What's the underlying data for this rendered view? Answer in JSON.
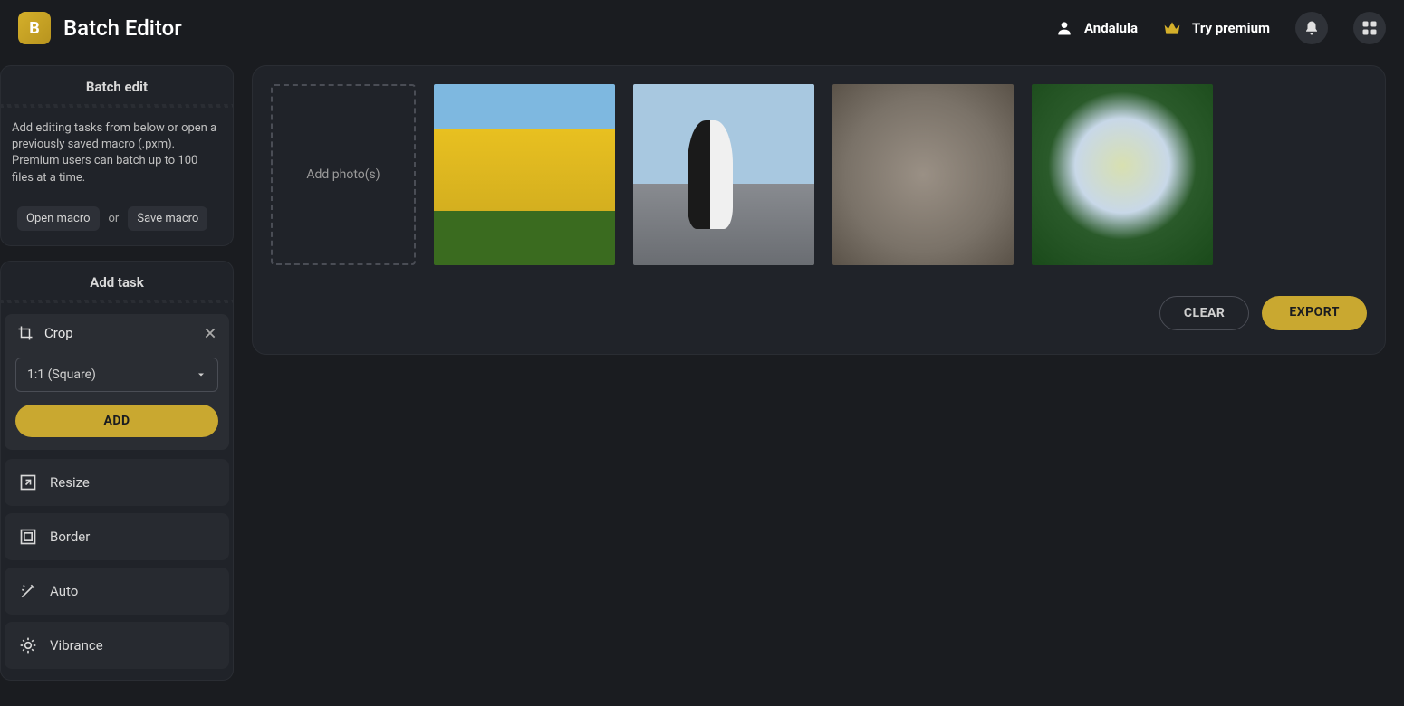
{
  "header": {
    "app_title": "Batch Editor",
    "user_name": "Andalula",
    "premium_label": "Try premium"
  },
  "sidebar": {
    "batch_edit": {
      "title": "Batch edit",
      "info": "Add editing tasks from below or open a previously saved macro (.pxm). Premium users can batch up to 100 files at a time.",
      "open_macro": "Open macro",
      "or": "or",
      "save_macro": "Save macro"
    },
    "add_task": {
      "title": "Add task",
      "crop": {
        "label": "Crop",
        "selected_option": "1:1 (Square)",
        "add_button": "ADD"
      },
      "items": [
        "Resize",
        "Border",
        "Auto",
        "Vibrance"
      ]
    }
  },
  "content": {
    "add_slot": "Add photo(s)",
    "thumbnails": [
      "tulips",
      "penguins",
      "koala",
      "hydrangea"
    ],
    "clear_button": "CLEAR",
    "export_button": "EXPORT"
  }
}
